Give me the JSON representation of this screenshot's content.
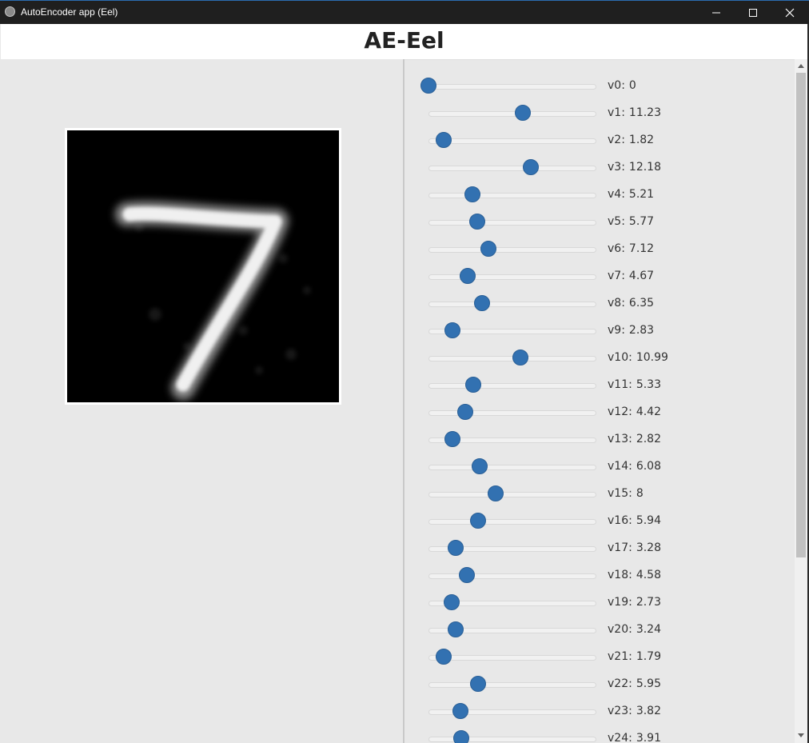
{
  "window": {
    "title": "AutoEncoder app (Eel)",
    "icon": "globe-icon",
    "buttons": [
      "minimize-icon",
      "maximize-icon",
      "close-icon"
    ]
  },
  "header": {
    "title": "AE-Eel"
  },
  "image": {
    "description_icon": "digit-image",
    "background": "#000000",
    "frame": "#ffffff"
  },
  "colors": {
    "accent": "#3271b1"
  },
  "slider_range": [
    0,
    20
  ],
  "sliders": [
    {
      "label": "v0:",
      "value": "0"
    },
    {
      "label": "v1:",
      "value": "11.23"
    },
    {
      "label": "v2:",
      "value": "1.82"
    },
    {
      "label": "v3:",
      "value": "12.18"
    },
    {
      "label": "v4:",
      "value": "5.21"
    },
    {
      "label": "v5:",
      "value": "5.77"
    },
    {
      "label": "v6:",
      "value": "7.12"
    },
    {
      "label": "v7:",
      "value": "4.67"
    },
    {
      "label": "v8:",
      "value": "6.35"
    },
    {
      "label": "v9:",
      "value": "2.83"
    },
    {
      "label": "v10:",
      "value": "10.99"
    },
    {
      "label": "v11:",
      "value": "5.33"
    },
    {
      "label": "v12:",
      "value": "4.42"
    },
    {
      "label": "v13:",
      "value": "2.82"
    },
    {
      "label": "v14:",
      "value": "6.08"
    },
    {
      "label": "v15:",
      "value": "8"
    },
    {
      "label": "v16:",
      "value": "5.94"
    },
    {
      "label": "v17:",
      "value": "3.28"
    },
    {
      "label": "v18:",
      "value": "4.58"
    },
    {
      "label": "v19:",
      "value": "2.73"
    },
    {
      "label": "v20:",
      "value": "3.24"
    },
    {
      "label": "v21:",
      "value": "1.79"
    },
    {
      "label": "v22:",
      "value": "5.95"
    },
    {
      "label": "v23:",
      "value": "3.82"
    },
    {
      "label": "v24:",
      "value": "3.91"
    }
  ]
}
